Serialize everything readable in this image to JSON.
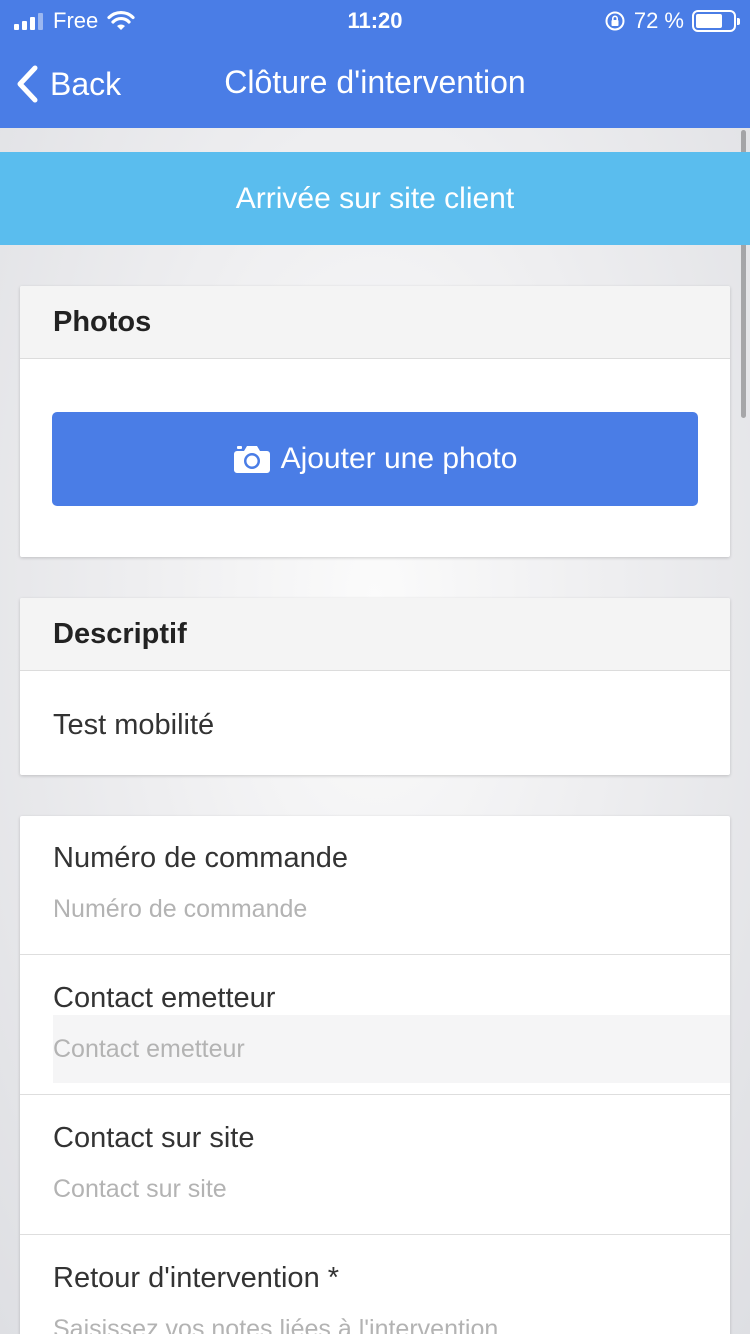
{
  "status_bar": {
    "carrier": "Free",
    "time": "11:20",
    "battery_percent": "72 %",
    "battery_level": 0.72
  },
  "nav": {
    "back_label": "Back",
    "title": "Clôture d'intervention"
  },
  "banner": {
    "label": "Arrivée sur site client"
  },
  "photos": {
    "header": "Photos",
    "add_button": "Ajouter une photo"
  },
  "descriptif": {
    "header": "Descriptif",
    "text": "Test mobilité"
  },
  "form": {
    "fields": [
      {
        "label": "Numéro de commande",
        "placeholder": "Numéro de commande"
      },
      {
        "label": "Contact emetteur",
        "placeholder": "Contact emetteur"
      },
      {
        "label": "Contact sur site",
        "placeholder": "Contact sur site"
      },
      {
        "label": "Retour d'intervention *",
        "placeholder": "Saisissez vos notes liées à l'intervention"
      }
    ]
  },
  "icons": [
    "signal-icon",
    "wifi-icon",
    "rotation-lock-icon",
    "battery-icon",
    "chevron-left-icon",
    "camera-icon"
  ],
  "colors": {
    "nav_blue": "#4a7de6",
    "banner_blue": "#5abdee"
  }
}
